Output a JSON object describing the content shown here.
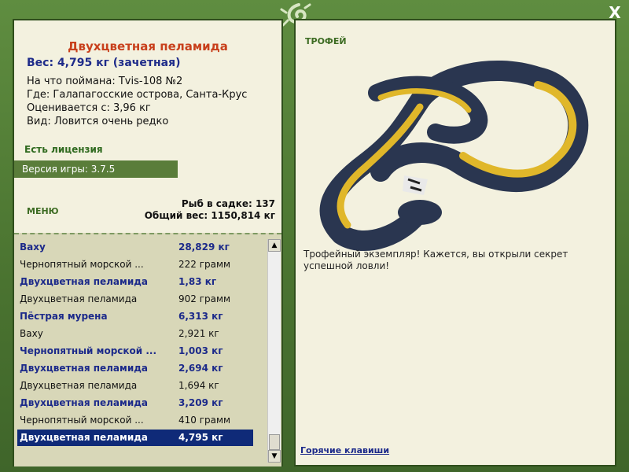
{
  "fish": {
    "title": "Двухцветная пеламида",
    "weight_line": "Вес: 4,795 кг (зачетная)",
    "caught_on": "На что поймана: Tvis-108 №2",
    "location": "Где: Галапагосские острова, Санта-Крус",
    "valued_from": "Оценивается с: 3,96 кг",
    "rarity": "Вид: Ловится очень редко"
  },
  "license_text": "Есть лицензия",
  "version_text": "Версия игры: 3.7.5",
  "menu_label": "МЕНЮ",
  "stats": {
    "fish_in_net": "Рыб в садке: 137",
    "total_weight": "Общий вес: 1150,814 кг"
  },
  "catch_list": [
    {
      "name": "Ваху",
      "weight": "28,829 кг",
      "bold": true
    },
    {
      "name": "Чернопятный морской ...",
      "weight": "222 грамм",
      "bold": false
    },
    {
      "name": "Двухцветная пеламида",
      "weight": "1,83 кг",
      "bold": true
    },
    {
      "name": "Двухцветная пеламида",
      "weight": "902 грамм",
      "bold": false
    },
    {
      "name": "Пёстрая мурена",
      "weight": "6,313 кг",
      "bold": true
    },
    {
      "name": "Ваху",
      "weight": "2,921 кг",
      "bold": false
    },
    {
      "name": "Чернопятный морской ...",
      "weight": "1,003 кг",
      "bold": true
    },
    {
      "name": "Двухцветная пеламида",
      "weight": "2,694 кг",
      "bold": true
    },
    {
      "name": "Двухцветная пеламида",
      "weight": "1,694 кг",
      "bold": false
    },
    {
      "name": "Двухцветная пеламида",
      "weight": "3,209 кг",
      "bold": true
    },
    {
      "name": "Чернопятный морской ...",
      "weight": "410 грамм",
      "bold": false
    },
    {
      "name": "Двухцветная пеламида",
      "weight": "4,795 кг",
      "bold": true,
      "selected": true
    }
  ],
  "trophy": {
    "label": "ТРОФЕЙ",
    "text": "Трофейный экземпляр! Кажется, вы открыли секрет успешной ловли!"
  },
  "hotkeys_label": "Горячие клавиши",
  "close_label": "X",
  "scroll_up": "▲",
  "scroll_down": "▼",
  "colors": {
    "frame": "#4f7a35",
    "panel": "#f3f1df",
    "title": "#c8401c",
    "highlight": "#1c2a8a",
    "selected_row": "#0f2a78"
  }
}
